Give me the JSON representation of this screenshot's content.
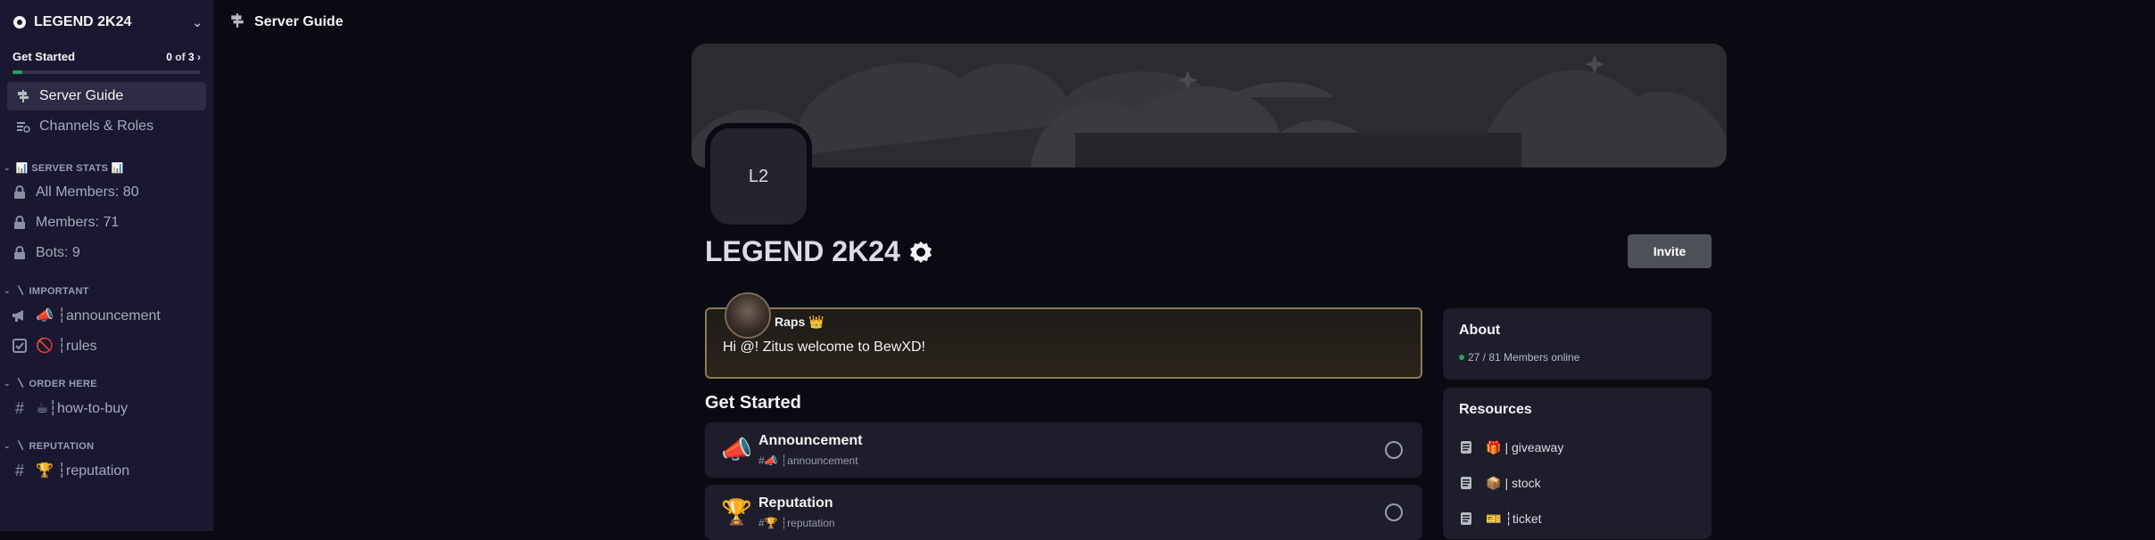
{
  "server": {
    "name": "LEGEND 2K24",
    "icon_initials": "L2",
    "invite_label": "Invite"
  },
  "get_started": {
    "label": "Get Started",
    "done": "0",
    "of_text": "of",
    "total": "3",
    "progress": 0.05
  },
  "nav": [
    {
      "label": "Server Guide",
      "icon": "signpost-icon",
      "active": true
    },
    {
      "label": "Channels & Roles",
      "icon": "channels-roles-icon",
      "active": false
    }
  ],
  "categories": [
    {
      "label": "📊 SERVER STATS 📊",
      "channels": [
        {
          "label": "All Members: 80",
          "icon": "lock-icon"
        },
        {
          "label": "Members: 71",
          "icon": "lock-icon"
        },
        {
          "label": "Bots: 9",
          "icon": "lock-icon"
        }
      ]
    },
    {
      "label": "〵 IMPORTANT",
      "channels": [
        {
          "label": "📣 ┆announcement",
          "icon": "megaphone-icon"
        },
        {
          "label": "🚫 ┆rules",
          "icon": "rules-icon"
        }
      ]
    },
    {
      "label": "〵 ORDER HERE",
      "channels": [
        {
          "label": "☕┆how-to-buy",
          "icon": "hash-icon"
        }
      ]
    },
    {
      "label": "〵 REPUTATION",
      "channels": [
        {
          "label": "🏆 ┆reputation",
          "icon": "hash-icon"
        }
      ]
    }
  ],
  "topbar": {
    "title": "Server Guide"
  },
  "welcome": {
    "author": "Raps 👑",
    "message": "Hi @! Zitus welcome to BewXD!"
  },
  "tasks_title": "Get Started",
  "tasks": [
    {
      "title": "Announcement",
      "sub": "#📣 ┆announcement",
      "emoji": "📣"
    },
    {
      "title": "Reputation",
      "sub": "#🏆 ┆reputation",
      "emoji": "🏆"
    }
  ],
  "about": {
    "title": "About",
    "online": "27 / 81 Members online"
  },
  "resources": {
    "title": "Resources",
    "items": [
      {
        "emoji": "🎁",
        "label": "| giveaway"
      },
      {
        "emoji": "📦",
        "label": "| stock"
      },
      {
        "emoji": "🎫",
        "label": "┆ticket"
      }
    ]
  },
  "colors": {
    "accent": "#23a55a",
    "sidebar_bg": "#1a1830",
    "page_bg": "#0b0a12",
    "banner": "#2b2b30"
  }
}
